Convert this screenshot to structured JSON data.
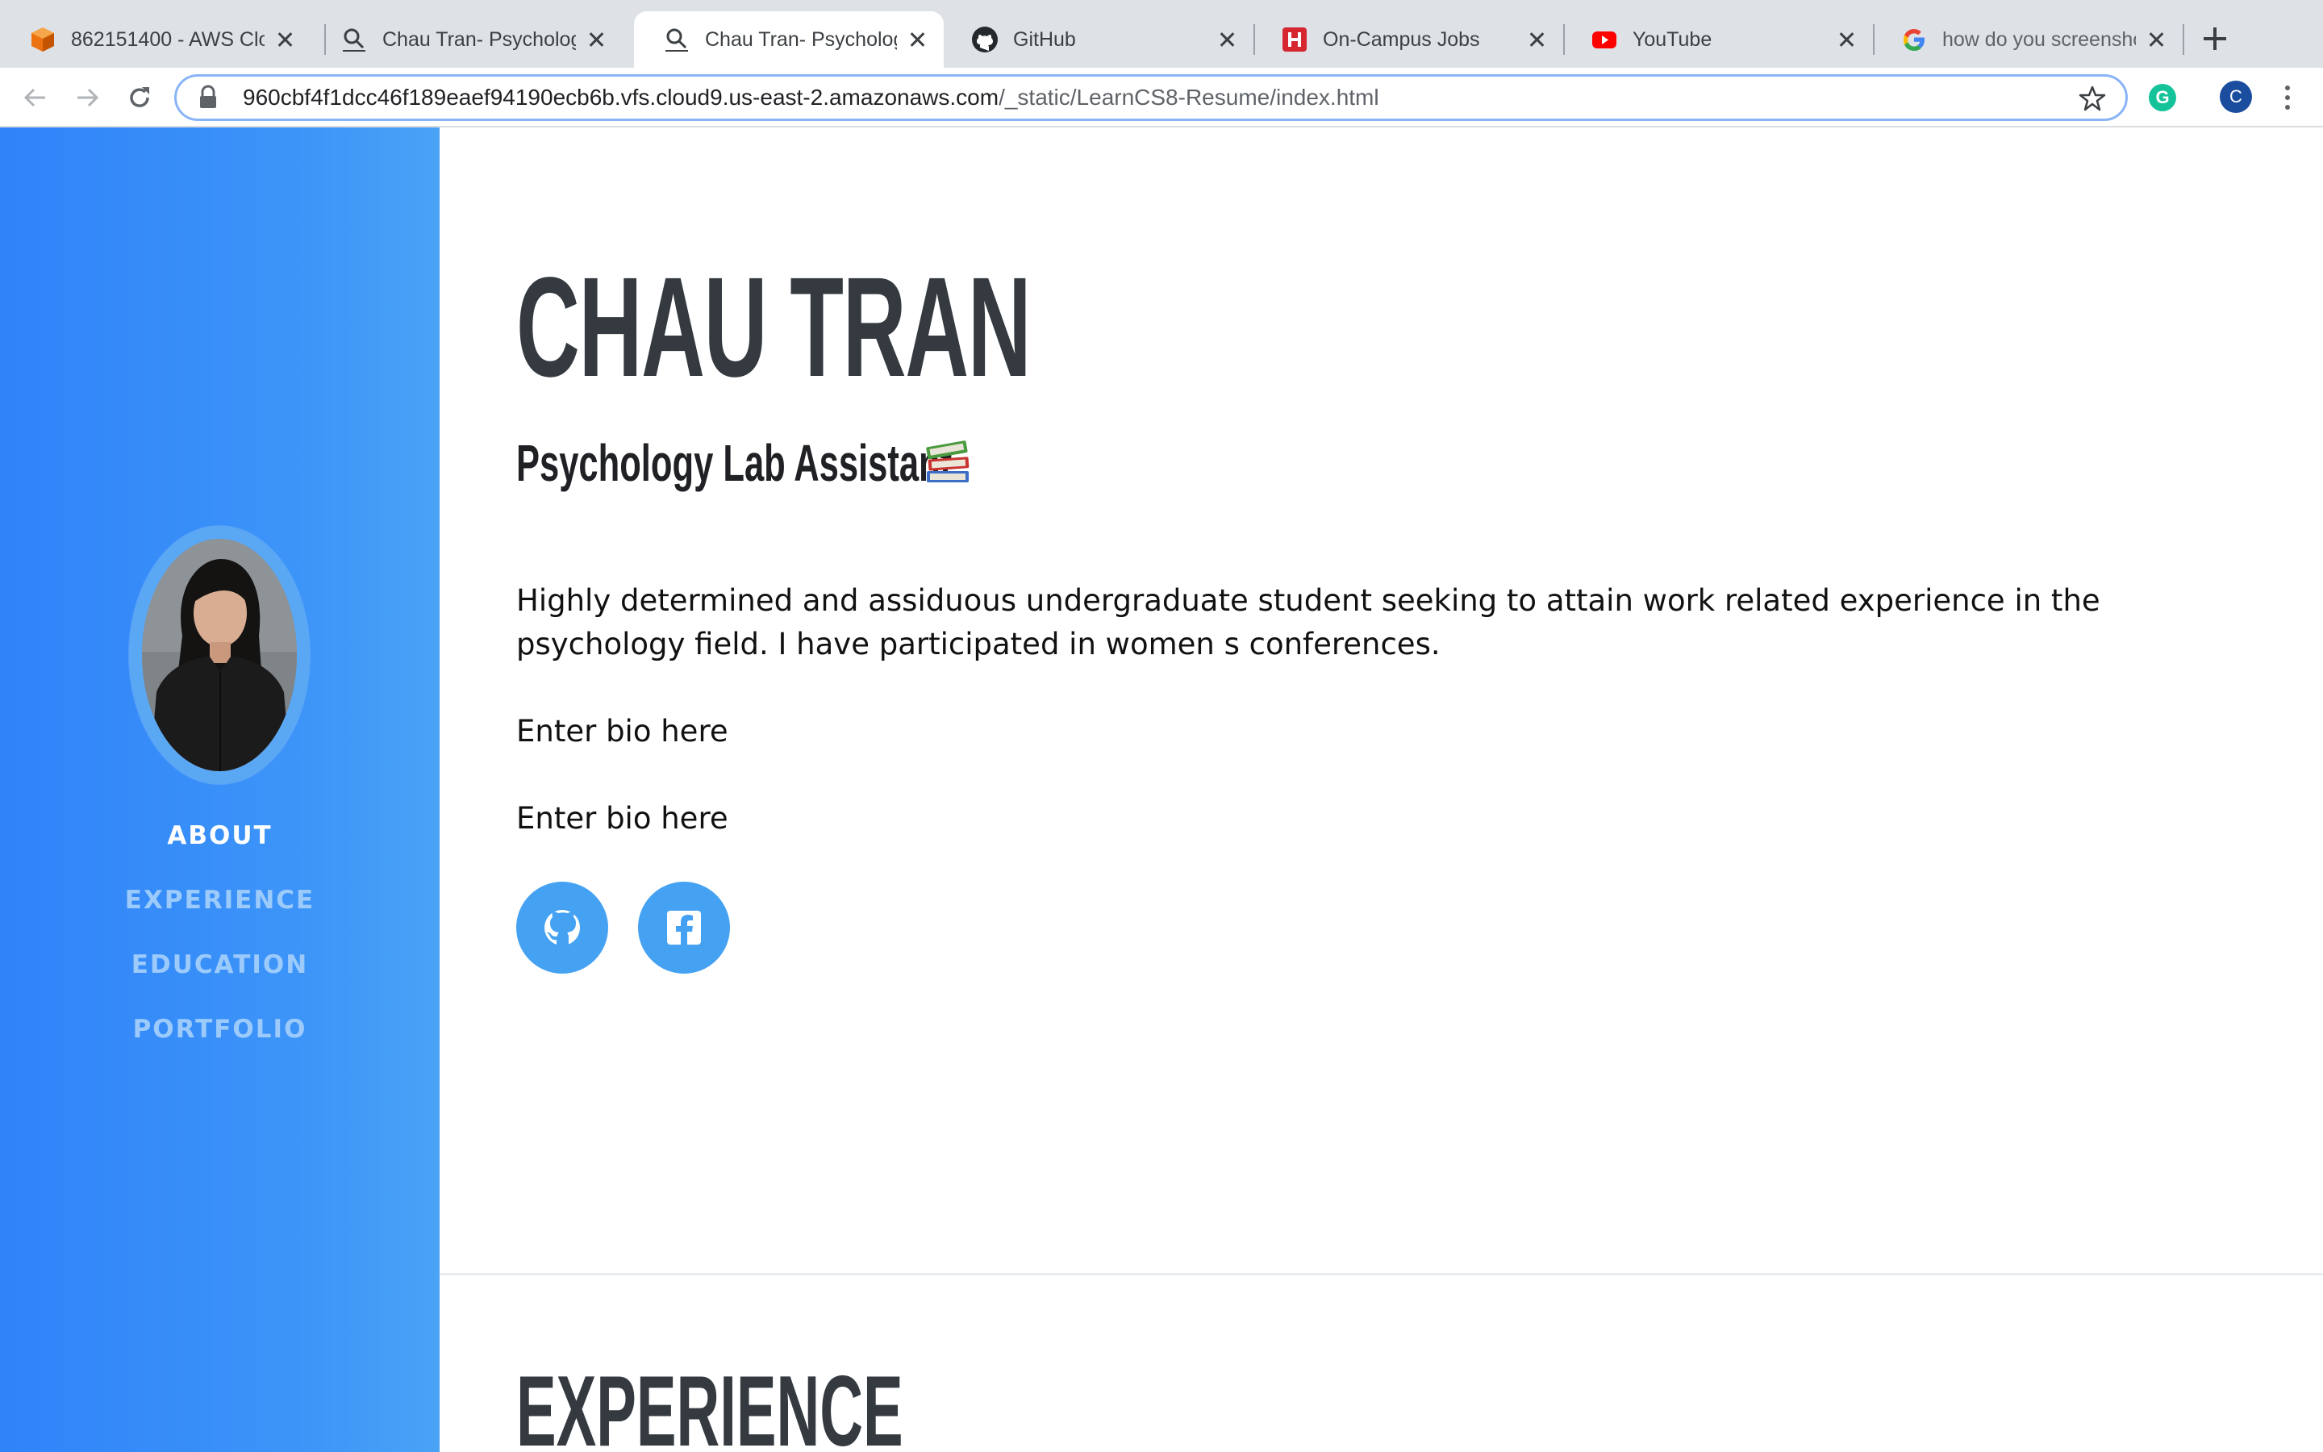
{
  "browser": {
    "tabs": [
      {
        "title": "862151400 - AWS Clo",
        "icon": "aws-cube-icon"
      },
      {
        "title": "Chau Tran- Psycholog",
        "icon": "page-search-icon"
      },
      {
        "title": "Chau Tran- Psycholog",
        "icon": "page-search-icon",
        "active": true
      },
      {
        "title": "GitHub",
        "icon": "github-icon"
      },
      {
        "title": "On-Campus Jobs",
        "icon": "handshake-icon"
      },
      {
        "title": "YouTube",
        "icon": "youtube-icon"
      },
      {
        "title": "how do you screensho",
        "icon": "google-icon"
      }
    ],
    "url_host": "960cbf4f1dcc46f189eaef94190ecb6b.vfs.cloud9.us-east-2.amazonaws.com",
    "url_path": "/_static/LearnCS8-Resume/index.html",
    "profile_initial": "C",
    "extension_initial": "G"
  },
  "sidebar": {
    "nav": [
      {
        "label": "ABOUT",
        "active": true
      },
      {
        "label": "EXPERIENCE"
      },
      {
        "label": "EDUCATION"
      },
      {
        "label": "PORTFOLIO"
      }
    ]
  },
  "about": {
    "name": "CHAU TRAN",
    "subtitle": "Psychology Lab Assistant",
    "bio": [
      "Highly determined and assiduous undergraduate student seeking to attain work related experience in the psychology field. I have participated in women s conferences.",
      "Enter bio here",
      "Enter bio here"
    ],
    "social": [
      "github-icon",
      "facebook-icon"
    ]
  },
  "experience": {
    "title": "EXPERIENCE"
  },
  "colors": {
    "sidebar_start": "#3083f9",
    "sidebar_end": "#4aa3f5",
    "social_button": "#45a2f3",
    "heading": "#343a40",
    "nav_inactive": "#9ccbfb"
  }
}
